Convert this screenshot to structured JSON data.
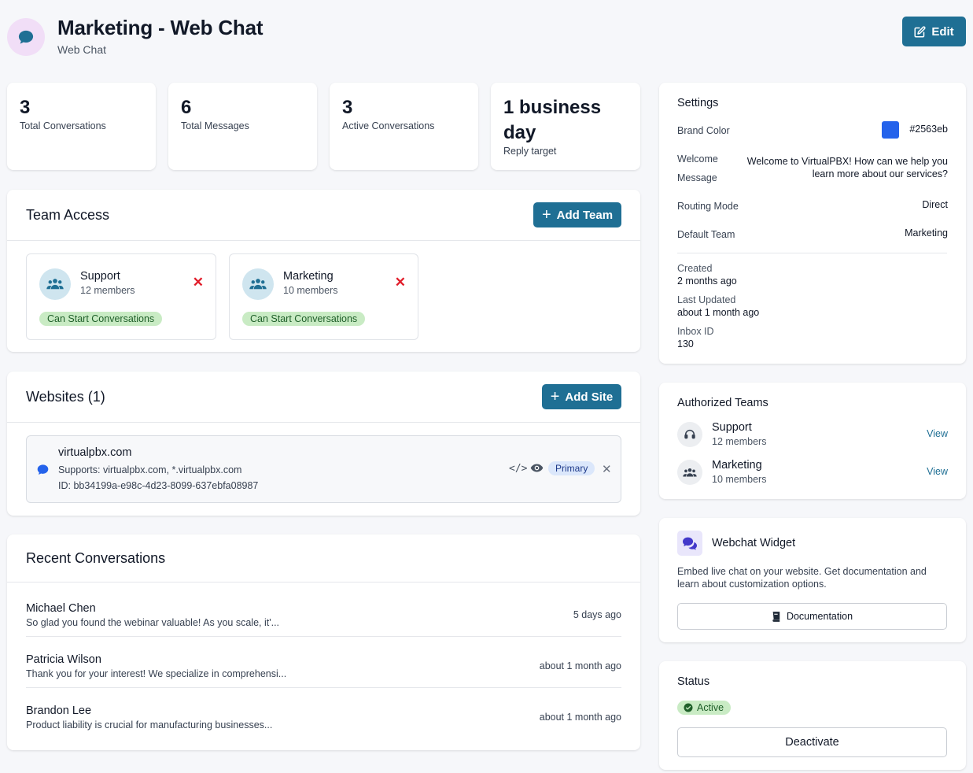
{
  "header": {
    "title": "Marketing - Web Chat",
    "subtitle": "Web Chat",
    "edit_label": "Edit"
  },
  "stats": [
    {
      "value": "3",
      "label": "Total Conversations"
    },
    {
      "value": "6",
      "label": "Total Messages"
    },
    {
      "value": "3",
      "label": "Active Conversations"
    },
    {
      "value": "1 business day",
      "label": "Reply target"
    }
  ],
  "team_access": {
    "title": "Team Access",
    "add_label": "Add Team",
    "teams": [
      {
        "name": "Support",
        "members": "12 members",
        "permission": "Can Start Conversations"
      },
      {
        "name": "Marketing",
        "members": "10 members",
        "permission": "Can Start Conversations"
      }
    ]
  },
  "websites": {
    "title": "Websites (1)",
    "add_label": "Add Site",
    "sites": [
      {
        "domain": "virtualpbx.com",
        "supports": "Supports: virtualpbx.com, *.virtualpbx.com",
        "id": "ID: bb34199a-e98c-4d23-8099-637ebfa08987",
        "badge": "Primary"
      }
    ]
  },
  "recent": {
    "title": "Recent Conversations",
    "items": [
      {
        "name": "Michael Chen",
        "preview": "So glad you found the webinar valuable! As you scale, it'...",
        "time": "5 days ago"
      },
      {
        "name": "Patricia Wilson",
        "preview": "Thank you for your interest! We specialize in comprehensi...",
        "time": "about 1 month ago"
      },
      {
        "name": "Brandon Lee",
        "preview": "Product liability is crucial for manufacturing businesses...",
        "time": "about 1 month ago"
      }
    ]
  },
  "settings": {
    "title": "Settings",
    "brand_color_label": "Brand Color",
    "brand_color": "#2563eb",
    "welcome_label_1": "Welcome",
    "welcome_label_2": "Message",
    "welcome_message": "Welcome to VirtualPBX! How can we help you learn more about our services?",
    "routing_label": "Routing Mode",
    "routing_value": "Direct",
    "default_team_label": "Default Team",
    "default_team_value": "Marketing",
    "created_label": "Created",
    "created_value": "2 months ago",
    "updated_label": "Last Updated",
    "updated_value": "about 1 month ago",
    "inbox_label": "Inbox ID",
    "inbox_value": "130"
  },
  "authorized": {
    "title": "Authorized Teams",
    "view_label": "View",
    "teams": [
      {
        "name": "Support",
        "members": "12 members"
      },
      {
        "name": "Marketing",
        "members": "10 members"
      }
    ]
  },
  "widget": {
    "title": "Webchat Widget",
    "description": "Embed live chat on your website. Get documentation and learn about customization options.",
    "doc_label": "Documentation"
  },
  "status": {
    "title": "Status",
    "badge": "Active",
    "deactivate_label": "Deactivate"
  },
  "colors": {
    "primary": "#1f6f94",
    "danger": "#e11d2a",
    "success_bg": "#c9ebc4",
    "brand": "#2563eb"
  }
}
